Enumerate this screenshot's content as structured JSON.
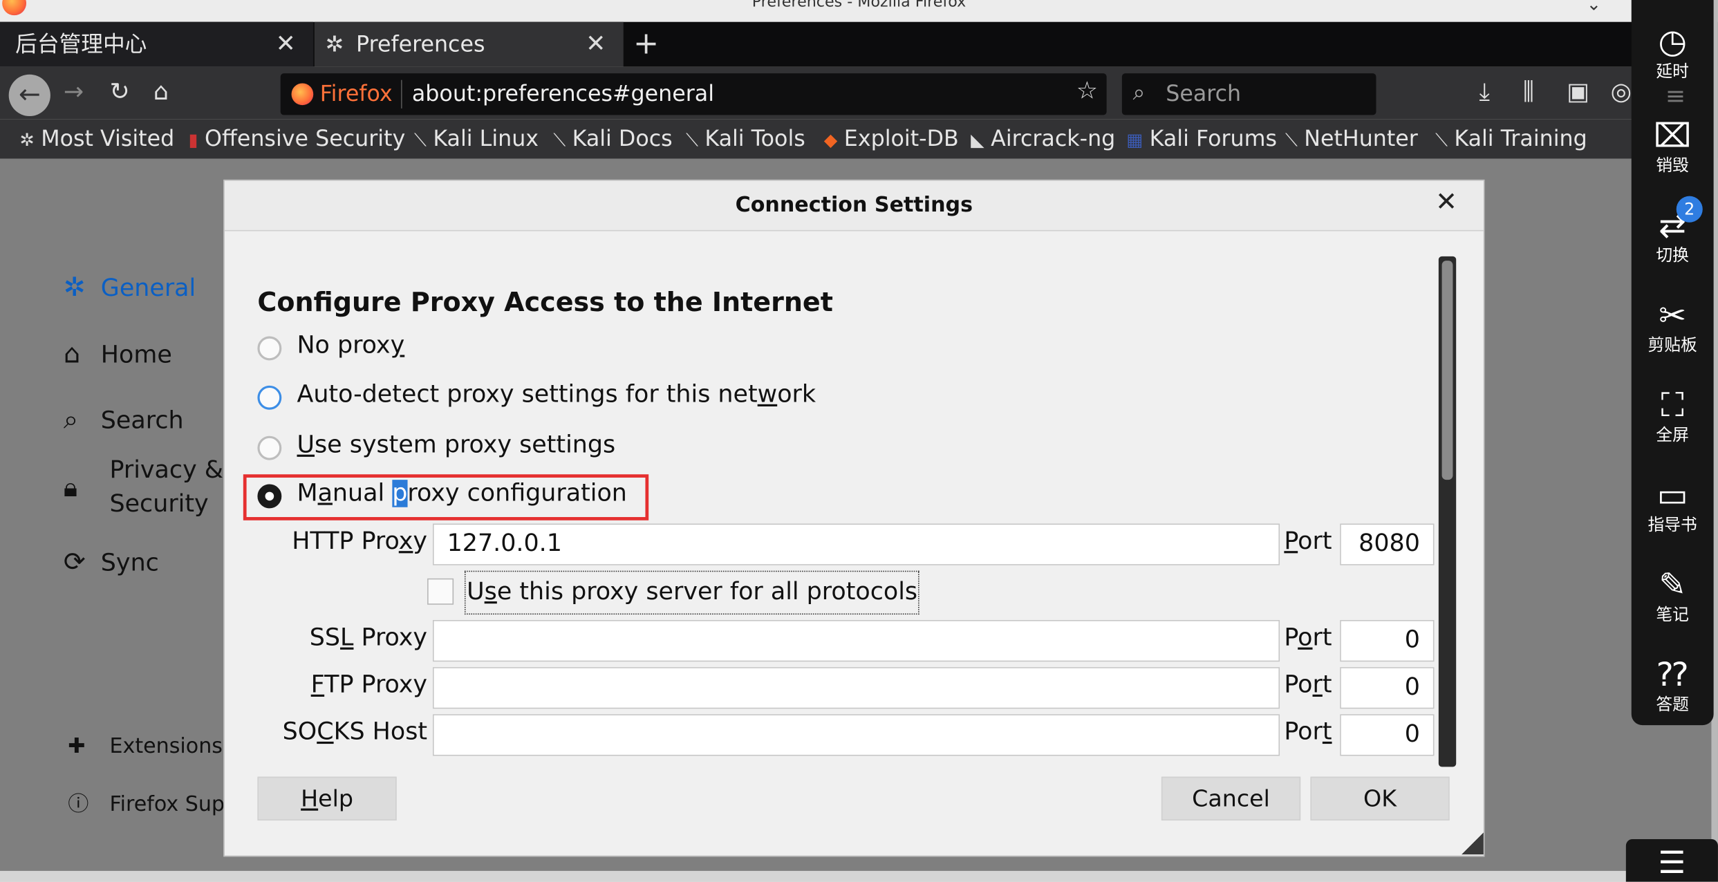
{
  "window": {
    "title": "Preferences - Mozilla Firefox",
    "controls": [
      "⌄",
      "▫",
      "✕"
    ]
  },
  "tabs": [
    {
      "label": "后台管理中心",
      "close": "✕"
    },
    {
      "label": "Preferences",
      "close": "✕",
      "icon": "gear-icon"
    }
  ],
  "new_tab": "+",
  "nav": {
    "back": "←",
    "forward": "→",
    "reload": "↻",
    "home": "⌂",
    "brand": "Firefox",
    "url": "about:preferences#general",
    "star": "☆",
    "search_placeholder": "Search",
    "download": "⤓",
    "library": "⫼",
    "sidebar": "▣",
    "account": "◎",
    "menu": "≡"
  },
  "bookmarks": [
    {
      "label": "Most Visited",
      "icon": "gear-icon"
    },
    {
      "label": "Offensive Security",
      "icon": "offsec-icon"
    },
    {
      "label": "Kali Linux",
      "icon": "kali-icon"
    },
    {
      "label": "Kali Docs",
      "icon": "kali-icon"
    },
    {
      "label": "Kali Tools",
      "icon": "kali-icon"
    },
    {
      "label": "Exploit-DB",
      "icon": "exploitdb-icon"
    },
    {
      "label": "Aircrack-ng",
      "icon": "aircrack-icon"
    },
    {
      "label": "Kali Forums",
      "icon": "forums-icon"
    },
    {
      "label": "NetHunter",
      "icon": "kali-icon"
    },
    {
      "label": "Kali Training",
      "icon": "kali-icon"
    }
  ],
  "sidebar": {
    "general": "General",
    "home": "Home",
    "search": "Search",
    "privacy_line1": "Privacy &",
    "privacy_line2": "Security",
    "sync": "Sync",
    "extensions": "Extensions",
    "support": "Firefox Sup"
  },
  "dialog": {
    "title": "Connection Settings",
    "close": "✕",
    "heading": "Configure Proxy Access to the Internet",
    "options": {
      "no_proxy": {
        "a": "No prox",
        "u": "y",
        "b": ""
      },
      "auto_detect": {
        "a": "Auto-detect proxy settings for this net",
        "u": "w",
        "b": "ork"
      },
      "system": {
        "a": "",
        "u": "U",
        "b": "se system proxy settings"
      },
      "manual": {
        "a": "M",
        "u": "a",
        "b": "nual ",
        "hl": "p",
        "c": "roxy configuration"
      }
    },
    "selected": "manual",
    "http": {
      "label_a": "HTTP Pro",
      "label_u": "x",
      "label_b": "y",
      "value": "127.0.0.1",
      "port_label_u": "P",
      "port_label_b": "ort",
      "port": "8080"
    },
    "all_protocols": {
      "a": "U",
      "u": "s",
      "b": "e this proxy server for all protocols",
      "checked": false
    },
    "ssl": {
      "label_a": "SS",
      "label_u": "L",
      "label_b": " Proxy",
      "value": "",
      "port_label_a": "P",
      "port_label_u": "o",
      "port_label_b": "rt",
      "port": "0"
    },
    "ftp": {
      "label_a": "",
      "label_u": "F",
      "label_b": "TP Proxy",
      "value": "",
      "port_label_a": "Po",
      "port_label_u": "r",
      "port_label_b": "t",
      "port": "0"
    },
    "socks": {
      "label_a": "SO",
      "label_u": "C",
      "label_b": "KS Host",
      "value": "",
      "port_label_a": "Por",
      "port_label_u": "t",
      "port_label_b": "",
      "port": "0"
    },
    "buttons": {
      "help_u": "H",
      "help_b": "elp",
      "cancel": "Cancel",
      "ok": "OK"
    }
  },
  "tool_sidebar": [
    {
      "icon": "clock-icon",
      "glyph": "◷",
      "label": "延时"
    },
    {
      "icon": "destroy-icon",
      "glyph": "⌧",
      "label": "销毁"
    },
    {
      "icon": "switch-icon",
      "glyph": "⇄",
      "label": "切换",
      "badge": "2"
    },
    {
      "icon": "scissors-icon",
      "glyph": "✂",
      "label": "剪贴板"
    },
    {
      "icon": "fullscreen-icon",
      "glyph": "⛶",
      "label": "全屏"
    },
    {
      "icon": "book-icon",
      "glyph": "▭",
      "label": "指导书"
    },
    {
      "icon": "pen-icon",
      "glyph": "✎",
      "label": "笔记"
    },
    {
      "icon": "question-icon",
      "glyph": "⁇",
      "label": "答题"
    }
  ],
  "tool_bottom": "☰",
  "colors": {
    "accent": "#3d8ee6",
    "highlight_box": "#e53030",
    "brand": "#ff7139",
    "sidebar_active": "#0a84ff"
  }
}
